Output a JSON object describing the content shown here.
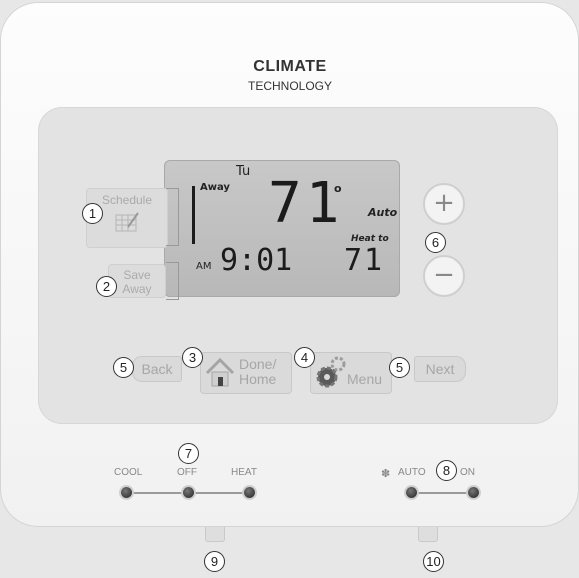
{
  "brand": {
    "line1": "CLIMATE",
    "line2": "TECHNOLOGY"
  },
  "display": {
    "day": "Tu",
    "away": "Away",
    "temp_current": "71",
    "degree": "o",
    "mode": "Auto",
    "heat_to": "Heat to",
    "am": "AM",
    "time": "9:01",
    "setpoint": "71"
  },
  "buttons": {
    "schedule": "Schedule",
    "save_away": "Save\nAway",
    "plus": "+",
    "minus": "−",
    "back": "Back",
    "done_home": "Done/\nHome",
    "menu": "Menu",
    "next": "Next"
  },
  "switches": {
    "system": {
      "cool": "COOL",
      "off": "OFF",
      "heat": "HEAT"
    },
    "fan": {
      "auto": "AUTO",
      "on": "ON"
    }
  },
  "callouts": [
    "1",
    "2",
    "3",
    "4",
    "5",
    "5",
    "6",
    "7",
    "8",
    "9",
    "10"
  ]
}
